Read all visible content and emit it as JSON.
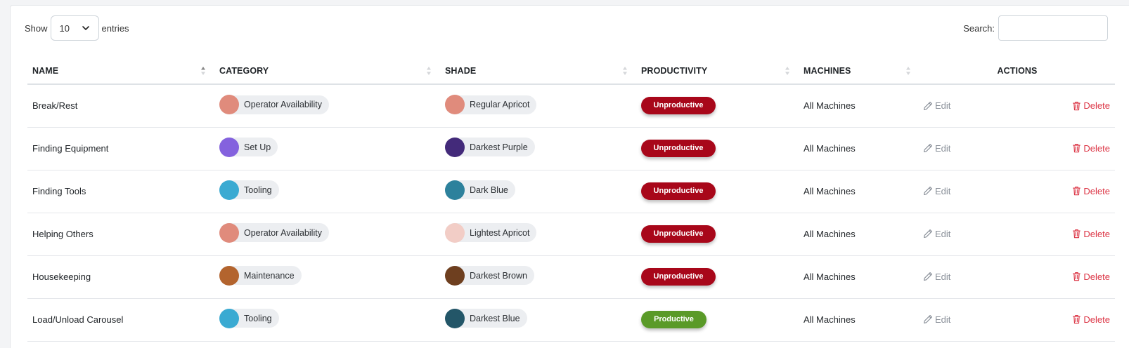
{
  "toolbar": {
    "show_label": "Show",
    "entries_value": "10",
    "entries_label": "entries",
    "search_label": "Search:",
    "search_value": ""
  },
  "columns": {
    "name": "NAME",
    "category": "CATEGORY",
    "shade": "SHADE",
    "productivity": "PRODUCTIVITY",
    "machines": "MACHINES",
    "actions": "ACTIONS"
  },
  "action_labels": {
    "edit": "Edit",
    "delete": "Delete"
  },
  "colors": {
    "unproductive": "#a8071a",
    "productive": "#5a9a28",
    "delete": "#dc3545",
    "edit": "#8a9099"
  },
  "rows": [
    {
      "name": "Break/Rest",
      "category": "Operator Availability",
      "category_color": "#e08b7c",
      "shade": "Regular Apricot",
      "shade_color": "#e08b7c",
      "productivity": "Unproductive",
      "machines": "All Machines"
    },
    {
      "name": "Finding Equipment",
      "category": "Set Up",
      "category_color": "#8462de",
      "shade": "Darkest Purple",
      "shade_color": "#432a7a",
      "productivity": "Unproductive",
      "machines": "All Machines"
    },
    {
      "name": "Finding Tools",
      "category": "Tooling",
      "category_color": "#3aaad2",
      "shade": "Dark Blue",
      "shade_color": "#2d819c",
      "productivity": "Unproductive",
      "machines": "All Machines"
    },
    {
      "name": "Helping Others",
      "category": "Operator Availability",
      "category_color": "#e08b7c",
      "shade": "Lightest Apricot",
      "shade_color": "#f2cdc6",
      "productivity": "Unproductive",
      "machines": "All Machines"
    },
    {
      "name": "Housekeeping",
      "category": "Maintenance",
      "category_color": "#b3642e",
      "shade": "Darkest Brown",
      "shade_color": "#6e3f1f",
      "productivity": "Unproductive",
      "machines": "All Machines"
    },
    {
      "name": "Load/Unload Carousel",
      "category": "Tooling",
      "category_color": "#3aaad2",
      "shade": "Darkest Blue",
      "shade_color": "#235668",
      "productivity": "Productive",
      "machines": "All Machines"
    }
  ]
}
